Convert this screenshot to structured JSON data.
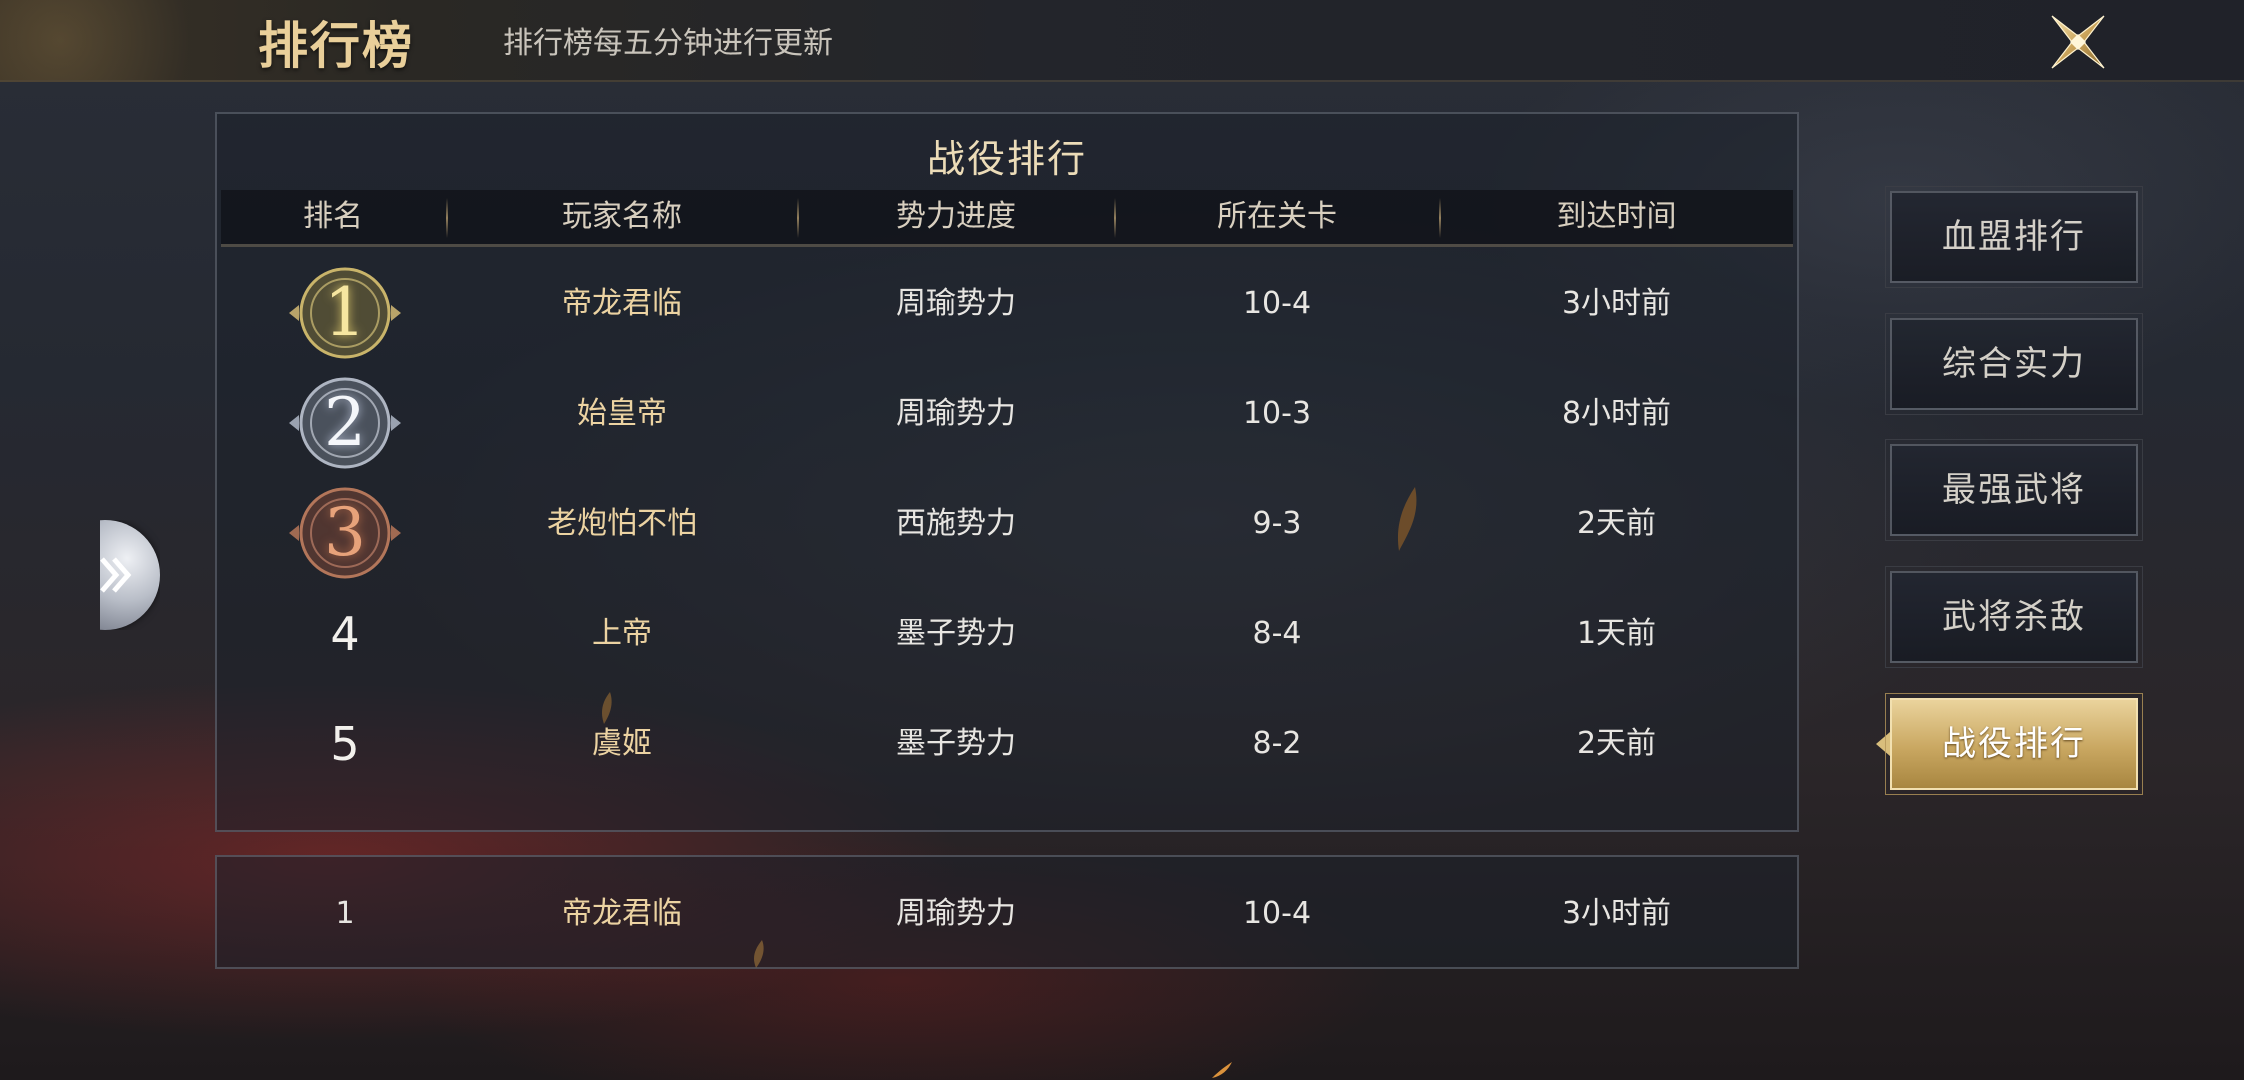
{
  "header": {
    "title": "排行榜",
    "subtitle": "排行榜每五分钟进行更新"
  },
  "panel": {
    "title": "战役排行",
    "columns": [
      "排名",
      "玩家名称",
      "势力进度",
      "所在关卡",
      "到达时间"
    ]
  },
  "rows": [
    {
      "rank": "1",
      "name": "帝龙君临",
      "faction": "周瑜势力",
      "stage": "10-4",
      "time": "3小时前"
    },
    {
      "rank": "2",
      "name": "始皇帝",
      "faction": "周瑜势力",
      "stage": "10-3",
      "time": "8小时前"
    },
    {
      "rank": "3",
      "name": "老炮怕不怕",
      "faction": "西施势力",
      "stage": "9-3",
      "time": "2天前"
    },
    {
      "rank": "4",
      "name": "上帝",
      "faction": "墨子势力",
      "stage": "8-4",
      "time": "1天前"
    },
    {
      "rank": "5",
      "name": "虞姬",
      "faction": "墨子势力",
      "stage": "8-2",
      "time": "2天前"
    }
  ],
  "my_rank": {
    "rank": "1",
    "name": "帝龙君临",
    "faction": "周瑜势力",
    "stage": "10-4",
    "time": "3小时前"
  },
  "tabs": [
    {
      "label": "血盟排行",
      "active": false
    },
    {
      "label": "综合实力",
      "active": false
    },
    {
      "label": "最强武将",
      "active": false
    },
    {
      "label": "武将杀敌",
      "active": false
    },
    {
      "label": "战役排行",
      "active": true
    }
  ],
  "icons": {
    "close": "close-x-icon",
    "expand": "chevron-right-double-icon",
    "medals": [
      "gold-medal-icon",
      "silver-medal-icon",
      "bronze-medal-icon"
    ]
  },
  "colors": {
    "accent_gold": "#c9a761",
    "title_gold": "#e9cf9a",
    "name_gold": "#ecd3a2"
  }
}
